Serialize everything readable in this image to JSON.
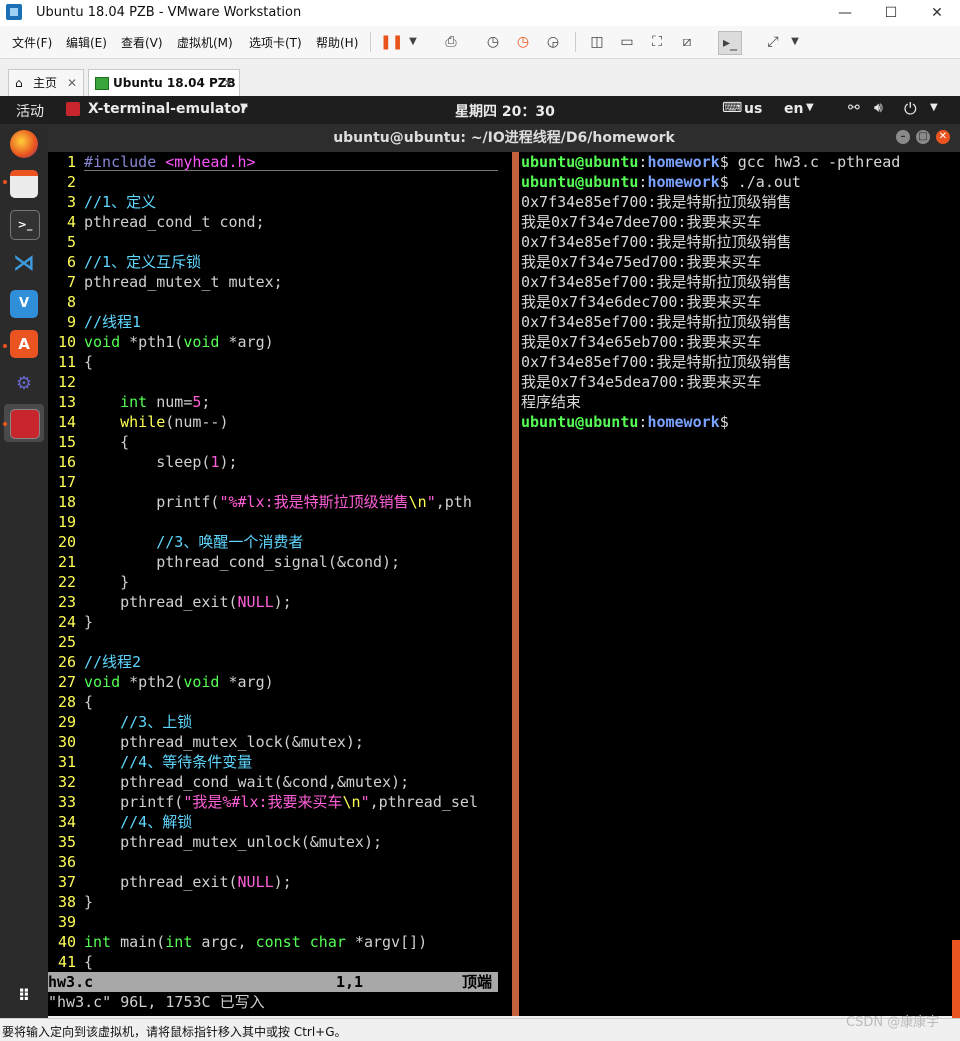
{
  "window": {
    "title": "Ubuntu 18.04 PZB - VMware Workstation",
    "controls": [
      "—",
      "☐",
      "✕"
    ]
  },
  "menu": {
    "items": [
      "文件(F)",
      "编辑(E)",
      "查看(V)",
      "虚拟机(M)",
      "选项卡(T)",
      "帮助(H)"
    ]
  },
  "tabs": [
    {
      "label": "主页",
      "close": "✕"
    },
    {
      "label": "Ubuntu 18.04 PZB",
      "close": "✕"
    }
  ],
  "gnome_panel": {
    "activities": "活动",
    "app_menu": "X-terminal-emulator",
    "clock": "星期四 20：30",
    "keyboard": "us",
    "lang": "en"
  },
  "terminal": {
    "title": "ubuntu@ubuntu: ~/IO进程线程/D6/homework"
  },
  "vim": {
    "lines": [
      {
        "n": "1",
        "segs": [
          {
            "c": "pp",
            "t": "#include "
          },
          {
            "c": "inc",
            "t": "<myhead.h>"
          }
        ]
      },
      {
        "n": "2",
        "segs": []
      },
      {
        "n": "3",
        "segs": [
          {
            "c": "cmt",
            "t": "//1、定义"
          }
        ]
      },
      {
        "n": "4",
        "segs": [
          {
            "c": "txt",
            "t": "pthread_cond_t cond;"
          }
        ]
      },
      {
        "n": "5",
        "segs": []
      },
      {
        "n": "6",
        "segs": [
          {
            "c": "cmt",
            "t": "//1、定义互斥锁"
          }
        ]
      },
      {
        "n": "7",
        "segs": [
          {
            "c": "txt",
            "t": "pthread_mutex_t mutex;"
          }
        ]
      },
      {
        "n": "8",
        "segs": []
      },
      {
        "n": "9",
        "segs": [
          {
            "c": "cmt",
            "t": "//线程1"
          }
        ]
      },
      {
        "n": "10",
        "segs": [
          {
            "c": "type",
            "t": "void"
          },
          {
            "c": "txt",
            "t": " *pth1("
          },
          {
            "c": "type",
            "t": "void"
          },
          {
            "c": "txt",
            "t": " *arg)"
          }
        ]
      },
      {
        "n": "11",
        "segs": [
          {
            "c": "txt",
            "t": "{"
          }
        ]
      },
      {
        "n": "12",
        "segs": []
      },
      {
        "n": "13",
        "segs": [
          {
            "c": "txt",
            "t": "    "
          },
          {
            "c": "type",
            "t": "int"
          },
          {
            "c": "txt",
            "t": " num="
          },
          {
            "c": "num",
            "t": "5"
          },
          {
            "c": "txt",
            "t": ";"
          }
        ]
      },
      {
        "n": "14",
        "segs": [
          {
            "c": "txt",
            "t": "    "
          },
          {
            "c": "kw",
            "t": "while"
          },
          {
            "c": "txt",
            "t": "(num--)"
          }
        ]
      },
      {
        "n": "15",
        "segs": [
          {
            "c": "txt",
            "t": "    {"
          }
        ]
      },
      {
        "n": "16",
        "segs": [
          {
            "c": "txt",
            "t": "        sleep("
          },
          {
            "c": "num",
            "t": "1"
          },
          {
            "c": "txt",
            "t": ");"
          }
        ]
      },
      {
        "n": "17",
        "segs": []
      },
      {
        "n": "18",
        "segs": [
          {
            "c": "txt",
            "t": "        printf("
          },
          {
            "c": "str",
            "t": "\"%#lx:我是特斯拉顶级销售"
          },
          {
            "c": "kw",
            "t": "\\n"
          },
          {
            "c": "str",
            "t": "\""
          },
          {
            "c": "txt",
            "t": ",pth"
          }
        ]
      },
      {
        "n": "19",
        "segs": []
      },
      {
        "n": "20",
        "segs": [
          {
            "c": "txt",
            "t": "        "
          },
          {
            "c": "cmt",
            "t": "//3、唤醒一个消费者"
          }
        ]
      },
      {
        "n": "21",
        "segs": [
          {
            "c": "txt",
            "t": "        pthread_cond_signal(&cond);"
          }
        ]
      },
      {
        "n": "22",
        "segs": [
          {
            "c": "txt",
            "t": "    }"
          }
        ]
      },
      {
        "n": "23",
        "segs": [
          {
            "c": "txt",
            "t": "    pthread_exit("
          },
          {
            "c": "num",
            "t": "NULL"
          },
          {
            "c": "txt",
            "t": ");"
          }
        ]
      },
      {
        "n": "24",
        "segs": [
          {
            "c": "txt",
            "t": "}"
          }
        ]
      },
      {
        "n": "25",
        "segs": []
      },
      {
        "n": "26",
        "segs": [
          {
            "c": "cmt",
            "t": "//线程2"
          }
        ]
      },
      {
        "n": "27",
        "segs": [
          {
            "c": "type",
            "t": "void"
          },
          {
            "c": "txt",
            "t": " *pth2("
          },
          {
            "c": "type",
            "t": "void"
          },
          {
            "c": "txt",
            "t": " *arg)"
          }
        ]
      },
      {
        "n": "28",
        "segs": [
          {
            "c": "txt",
            "t": "{"
          }
        ]
      },
      {
        "n": "29",
        "segs": [
          {
            "c": "txt",
            "t": "    "
          },
          {
            "c": "cmt",
            "t": "//3、上锁"
          }
        ]
      },
      {
        "n": "30",
        "segs": [
          {
            "c": "txt",
            "t": "    pthread_mutex_lock(&mutex);"
          }
        ]
      },
      {
        "n": "31",
        "segs": [
          {
            "c": "txt",
            "t": "    "
          },
          {
            "c": "cmt",
            "t": "//4、等待条件变量"
          }
        ]
      },
      {
        "n": "32",
        "segs": [
          {
            "c": "txt",
            "t": "    pthread_cond_wait(&cond,&mutex);"
          }
        ]
      },
      {
        "n": "33",
        "segs": [
          {
            "c": "txt",
            "t": "    printf("
          },
          {
            "c": "str",
            "t": "\"我是%#lx:我要来买车"
          },
          {
            "c": "kw",
            "t": "\\n"
          },
          {
            "c": "str",
            "t": "\""
          },
          {
            "c": "txt",
            "t": ",pthread_sel"
          }
        ]
      },
      {
        "n": "34",
        "segs": [
          {
            "c": "txt",
            "t": "    "
          },
          {
            "c": "cmt",
            "t": "//4、解锁"
          }
        ]
      },
      {
        "n": "35",
        "segs": [
          {
            "c": "txt",
            "t": "    pthread_mutex_unlock(&mutex);"
          }
        ]
      },
      {
        "n": "36",
        "segs": []
      },
      {
        "n": "37",
        "segs": [
          {
            "c": "txt",
            "t": "    pthread_exit("
          },
          {
            "c": "num",
            "t": "NULL"
          },
          {
            "c": "txt",
            "t": ");"
          }
        ]
      },
      {
        "n": "38",
        "segs": [
          {
            "c": "txt",
            "t": "}"
          }
        ]
      },
      {
        "n": "39",
        "segs": []
      },
      {
        "n": "40",
        "segs": [
          {
            "c": "type",
            "t": "int"
          },
          {
            "c": "txt",
            "t": " main("
          },
          {
            "c": "type",
            "t": "int"
          },
          {
            "c": "txt",
            "t": " argc, "
          },
          {
            "c": "type",
            "t": "const char"
          },
          {
            "c": "txt",
            "t": " *argv[])"
          }
        ]
      },
      {
        "n": "41",
        "segs": [
          {
            "c": "txt",
            "t": "{"
          }
        ]
      }
    ],
    "status_file": "hw3.c",
    "status_pos": "1,1",
    "status_scroll": "顶端",
    "message": "\"hw3.c\" 96L, 1753C 已写入"
  },
  "shell": {
    "lines": [
      {
        "type": "prompt",
        "user": "ubuntu@ubuntu",
        "path": "homework",
        "cmd": " gcc hw3.c -pthread"
      },
      {
        "type": "prompt",
        "user": "ubuntu@ubuntu",
        "path": "homework",
        "cmd": " ./a.out"
      },
      {
        "type": "out",
        "text": "0x7f34e85ef700:我是特斯拉顶级销售"
      },
      {
        "type": "out",
        "text": "我是0x7f34e7dee700:我要来买车"
      },
      {
        "type": "out",
        "text": "0x7f34e85ef700:我是特斯拉顶级销售"
      },
      {
        "type": "out",
        "text": "我是0x7f34e75ed700:我要来买车"
      },
      {
        "type": "out",
        "text": "0x7f34e85ef700:我是特斯拉顶级销售"
      },
      {
        "type": "out",
        "text": "我是0x7f34e6dec700:我要来买车"
      },
      {
        "type": "out",
        "text": "0x7f34e85ef700:我是特斯拉顶级销售"
      },
      {
        "type": "out",
        "text": "我是0x7f34e65eb700:我要来买车"
      },
      {
        "type": "out",
        "text": "0x7f34e85ef700:我是特斯拉顶级销售"
      },
      {
        "type": "out",
        "text": "我是0x7f34e5dea700:我要来买车"
      },
      {
        "type": "out",
        "text": "程序结束"
      },
      {
        "type": "prompt",
        "user": "ubuntu@ubuntu",
        "path": "homework",
        "cmd": ""
      }
    ]
  },
  "statusbar": {
    "text": "要将输入定向到该虚拟机，请将鼠标指针移入其中或按 Ctrl+G。",
    "watermark": "CSDN @康康宇"
  },
  "colors": {
    "ubuntu_orange": "#e95420",
    "terminal_bg": "#000000"
  }
}
